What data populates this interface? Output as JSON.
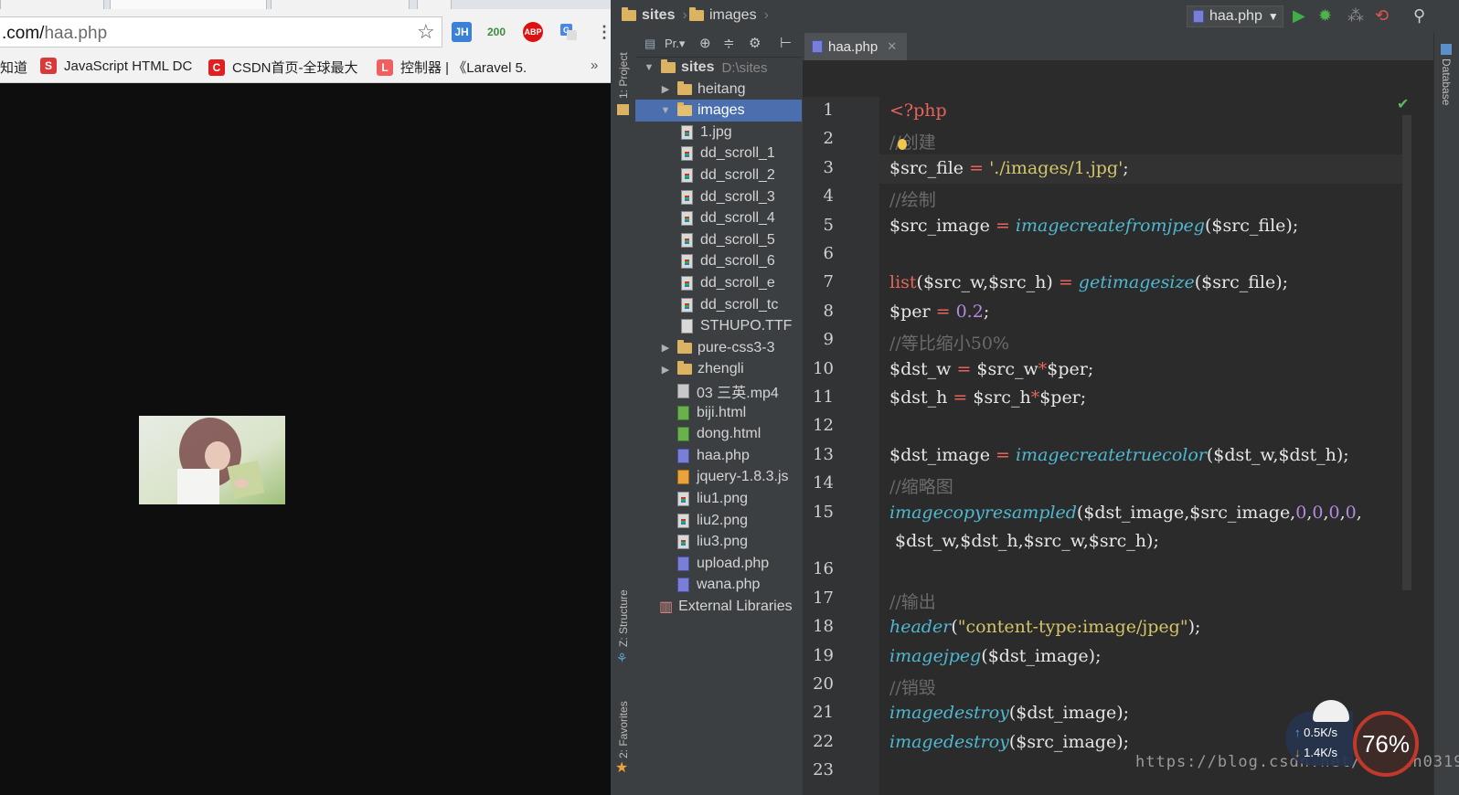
{
  "browser": {
    "url_host": ".com/",
    "url_path": "haa.php",
    "ext_jh": "JH",
    "ext_200": "200",
    "ext_abp": "ABP",
    "bookmarks": [
      {
        "label": "知道",
        "icon": ""
      },
      {
        "label": "JavaScript HTML DC",
        "icon": "S"
      },
      {
        "label": "CSDN首页-全球最大",
        "icon": "C"
      },
      {
        "label": "控制器 | 《Laravel 5.",
        "icon": "L"
      }
    ],
    "more_bookmarks": "»",
    "star": "☆"
  },
  "ide": {
    "breadcrumb_root": "sites",
    "breadcrumb_child": "images",
    "run_config": "haa.php",
    "project_view_label": "Pr.▾",
    "side_project": "1: Project",
    "side_structure": "Z: Structure",
    "side_favorites": "2: Favorites",
    "side_database": "Database",
    "tree": [
      {
        "label": "sites",
        "hint": "D:\\sites",
        "type": "folder",
        "depth": 0,
        "expanded": true
      },
      {
        "label": "heitang",
        "type": "folder",
        "depth": 1,
        "expanded": false
      },
      {
        "label": "images",
        "type": "folder",
        "depth": 1,
        "expanded": true,
        "selected": true
      },
      {
        "label": "1.jpg",
        "type": "img",
        "depth": 2
      },
      {
        "label": "dd_scroll_1",
        "type": "img",
        "depth": 2
      },
      {
        "label": "dd_scroll_2",
        "type": "img",
        "depth": 2
      },
      {
        "label": "dd_scroll_3",
        "type": "img",
        "depth": 2
      },
      {
        "label": "dd_scroll_4",
        "type": "img",
        "depth": 2
      },
      {
        "label": "dd_scroll_5",
        "type": "img",
        "depth": 2
      },
      {
        "label": "dd_scroll_6",
        "type": "img",
        "depth": 2
      },
      {
        "label": "dd_scroll_e",
        "type": "img",
        "depth": 2
      },
      {
        "label": "dd_scroll_tc",
        "type": "img",
        "depth": 2
      },
      {
        "label": "STHUPO.TTF",
        "type": "file",
        "depth": 2
      },
      {
        "label": "pure-css3-3",
        "type": "folder",
        "depth": 1,
        "expanded": false
      },
      {
        "label": "zhengli",
        "type": "folder",
        "depth": 1,
        "expanded": false
      },
      {
        "label": "03 三英.mp4",
        "type": "mp4",
        "depth": 1
      },
      {
        "label": "biji.html",
        "type": "html",
        "depth": 1
      },
      {
        "label": "dong.html",
        "type": "html",
        "depth": 1
      },
      {
        "label": "haa.php",
        "type": "php",
        "depth": 1
      },
      {
        "label": "jquery-1.8.3.js",
        "type": "js",
        "depth": 1
      },
      {
        "label": "liu1.png",
        "type": "img",
        "depth": 1
      },
      {
        "label": "liu2.png",
        "type": "img",
        "depth": 1
      },
      {
        "label": "liu3.png",
        "type": "img",
        "depth": 1
      },
      {
        "label": "upload.php",
        "type": "php",
        "depth": 1
      },
      {
        "label": "wana.php",
        "type": "php",
        "depth": 1
      },
      {
        "label": "External Libraries",
        "type": "lib",
        "depth": 0
      }
    ],
    "editor_tab": "haa.php",
    "line_numbers": [
      "1",
      "2",
      "3",
      "4",
      "5",
      "6",
      "7",
      "8",
      "9",
      "10",
      "11",
      "12",
      "13",
      "14",
      "15",
      "",
      "16",
      "17",
      "18",
      "19",
      "20",
      "21",
      "22",
      "23"
    ],
    "code": [
      "<?php",
      "//创建",
      "$src_file = './images/1.jpg';",
      "//绘制",
      "$src_image = imagecreatefromjpeg($src_file);",
      "",
      "list($src_w,$src_h) = getimagesize($src_file);",
      "$per = 0.2;",
      "//等比缩小50%",
      "$dst_w = $src_w*$per;",
      "$dst_h = $src_h*$per;",
      "",
      "$dst_image = imagecreatetruecolor($dst_w,$dst_h);",
      "//缩略图",
      "imagecopyresampled($dst_image,$src_image,0,0,0,0,",
      " $dst_w,$dst_h,$src_w,$src_h);",
      "",
      "//输出",
      "header(\"content-type:image/jpeg\");",
      "imagejpeg($dst_image);",
      "//销毁",
      "imagedestroy($dst_image);",
      "imagedestroy($src_image);",
      ""
    ]
  },
  "overlay": {
    "watermark": "https://blog.csdn.net/liuqun0319",
    "net_up": "0.5K/s",
    "net_down": "1.4K/s",
    "gauge": "76%"
  },
  "colors": {
    "keyword": "#cc7832",
    "function": "#4fb8d0",
    "string": "#d4c56a",
    "number": "#b48ade",
    "comment": "#6b6b6b",
    "selection": "#4b6eaf"
  }
}
